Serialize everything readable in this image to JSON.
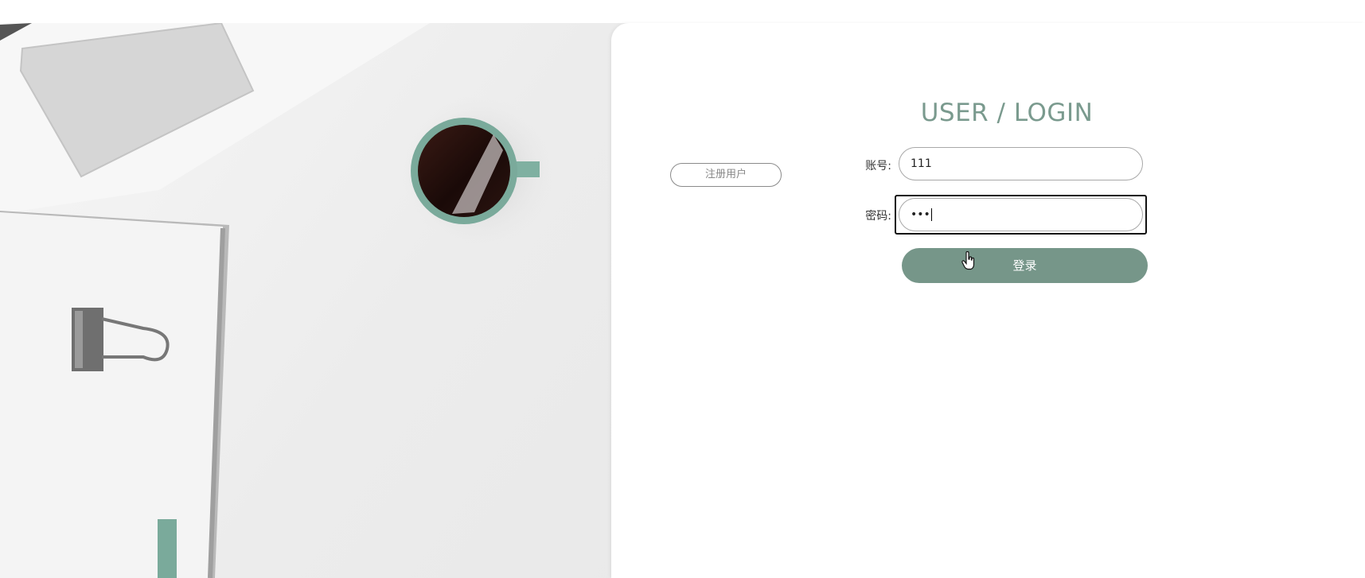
{
  "login": {
    "title": "USER / LOGIN",
    "register_label": "注册用户",
    "account_label": "账号:",
    "account_value": "111",
    "password_label": "密码:",
    "password_value": "•••",
    "submit_label": "登录"
  },
  "colors": {
    "accent": "#769689",
    "title": "#7a9a8e",
    "card_background": "#ffffff",
    "input_border": "#a8a8a8"
  },
  "icons": {
    "cursor": "hand-pointer-icon"
  }
}
